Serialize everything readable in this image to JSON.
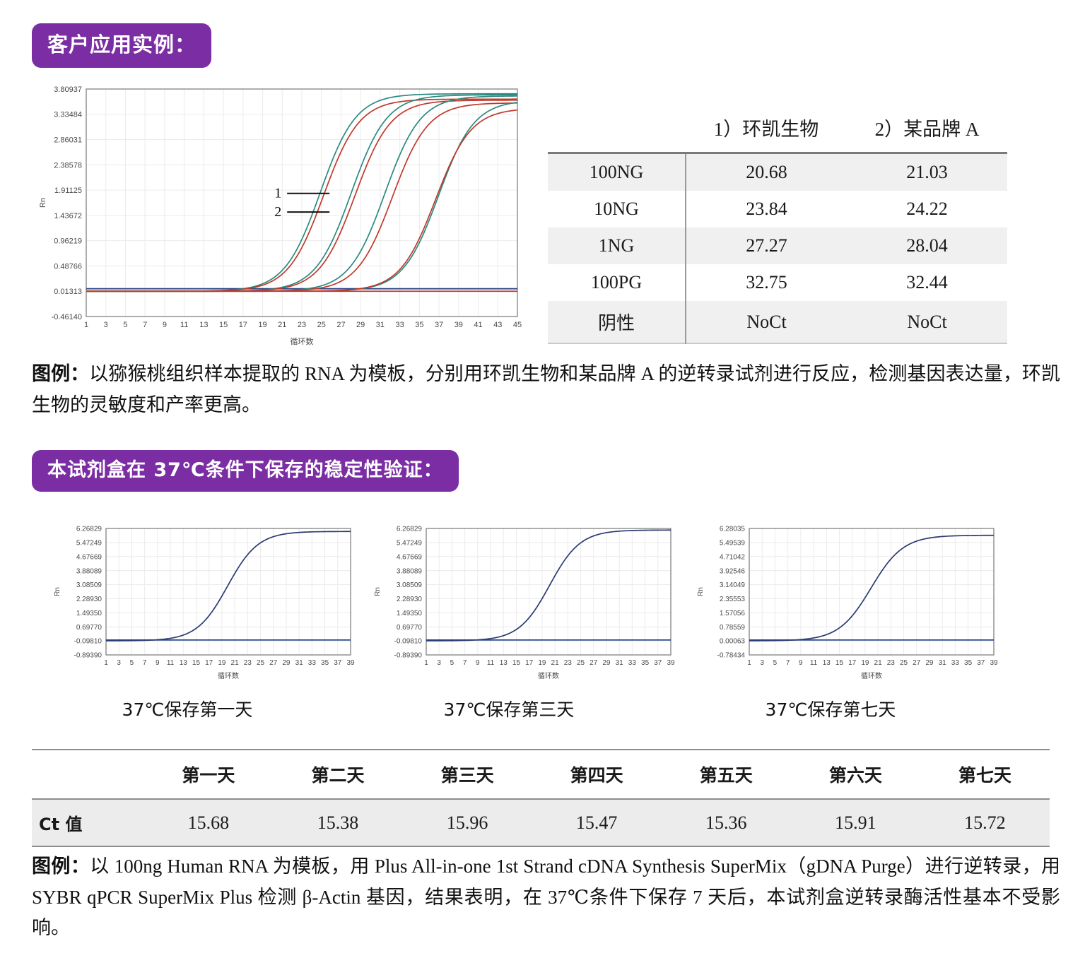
{
  "section1": {
    "badge": "客户应用实例：",
    "caption_prefix": "图例：",
    "caption": "以猕猴桃组织样本提取的 RNA 为模板，分别用环凯生物和某品牌 A 的逆转录试剂进行反应，检测基因表达量，环凯生物的灵敏度和产率更高。",
    "table": {
      "headers": [
        "",
        "1）环凯生物",
        "2）某品牌 A"
      ],
      "rows": [
        {
          "label": "100NG",
          "huankai": "20.68",
          "brand_a": "21.03"
        },
        {
          "label": "10NG",
          "huankai": "23.84",
          "brand_a": "24.22"
        },
        {
          "label": "1NG",
          "huankai": "27.27",
          "brand_a": "28.04"
        },
        {
          "label": "100PG",
          "huankai": "32.75",
          "brand_a": "32.44"
        },
        {
          "label": "阴性",
          "huankai": "NoCt",
          "brand_a": "NoCt"
        }
      ]
    }
  },
  "section2": {
    "badge": "本试剂盒在 37℃条件下保存的稳定性验证：",
    "chart_labels": [
      "37℃保存第一天",
      "37℃保存第三天",
      "37℃保存第七天"
    ],
    "caption_prefix": "图例：",
    "caption": "以 100ng Human RNA 为模板，用 Plus All-in-one 1st Strand cDNA Synthesis SuperMix（gDNA Purge）进行逆转录，用 SYBR qPCR SuperMix Plus 检测 β-Actin 基因，结果表明，在 37℃条件下保存 7 天后，本试剂盒逆转录酶活性基本不受影响。",
    "ct_table": {
      "row_header": "Ct 值",
      "headers": [
        "第一天",
        "第二天",
        "第三天",
        "第四天",
        "第五天",
        "第六天",
        "第七天"
      ],
      "values": [
        "15.68",
        "15.38",
        "15.96",
        "15.47",
        "15.36",
        "15.91",
        "15.72"
      ]
    }
  },
  "colors": {
    "badge_purple": "#7b2ea3",
    "curve_teal": "#2a8a80",
    "curve_red": "#c0392b",
    "curve_navy": "#2b3a72",
    "threshold_blue": "#2c4a8c",
    "grid": "#ebebeb",
    "axis": "#8a8a8a"
  },
  "chart_data": [
    {
      "id": "amplification-comparison",
      "type": "line",
      "title": "",
      "xlabel": "循环数",
      "ylabel": "Rn",
      "xlim": [
        1,
        45
      ],
      "xticks": [
        1,
        3,
        5,
        7,
        9,
        11,
        13,
        15,
        17,
        19,
        21,
        23,
        25,
        27,
        29,
        31,
        33,
        35,
        37,
        39,
        41,
        43,
        45
      ],
      "ylim": [
        -0.4614,
        3.80937
      ],
      "yticks": [
        3.80937,
        3.33484,
        2.86031,
        2.38578,
        1.91125,
        1.43672,
        0.96219,
        0.48766,
        0.01313,
        -0.4614
      ],
      "grid": true,
      "threshold": 0.06,
      "annotations": [
        {
          "text": "1",
          "target_series": "环凯生物",
          "x": 21.5,
          "y": 1.85
        },
        {
          "text": "2",
          "target_series": "某品牌 A",
          "x": 21.5,
          "y": 1.5
        }
      ],
      "series": [
        {
          "name": "环凯生物 100NG",
          "color": "#2a8a80",
          "ct": 20.68,
          "plateau": 3.72,
          "slope": 0.55,
          "baseline": 0.013
        },
        {
          "name": "某品牌 A 100NG",
          "color": "#c0392b",
          "ct": 21.03,
          "plateau": 3.62,
          "slope": 0.55,
          "baseline": 0.013
        },
        {
          "name": "环凯生物 10NG",
          "color": "#2a8a80",
          "ct": 23.84,
          "plateau": 3.7,
          "slope": 0.55,
          "baseline": 0.013
        },
        {
          "name": "某品牌 A 10NG",
          "color": "#c0392b",
          "ct": 24.22,
          "plateau": 3.6,
          "slope": 0.55,
          "baseline": 0.013
        },
        {
          "name": "环凯生物 1NG",
          "color": "#2a8a80",
          "ct": 27.27,
          "plateau": 3.68,
          "slope": 0.55,
          "baseline": 0.013
        },
        {
          "name": "某品牌 A 1NG",
          "color": "#c0392b",
          "ct": 28.04,
          "plateau": 3.55,
          "slope": 0.55,
          "baseline": 0.013
        },
        {
          "name": "环凯生物 100PG",
          "color": "#2a8a80",
          "ct": 32.75,
          "plateau": 3.6,
          "slope": 0.55,
          "baseline": 0.013
        },
        {
          "name": "某品牌 A 100PG",
          "color": "#c0392b",
          "ct": 32.44,
          "plateau": 3.45,
          "slope": 0.55,
          "baseline": 0.013
        },
        {
          "name": "阴性 NoCt",
          "color": "#c0392b",
          "ct": null,
          "plateau": 0.013,
          "slope": 0,
          "baseline": 0.013
        }
      ]
    },
    {
      "id": "stability-day1",
      "type": "line",
      "title": "37℃保存第一天",
      "xlabel": "循环数",
      "ylabel": "Rn",
      "xlim": [
        1,
        39
      ],
      "xticks": [
        1,
        3,
        5,
        7,
        9,
        11,
        13,
        15,
        17,
        19,
        21,
        23,
        25,
        27,
        29,
        31,
        33,
        35,
        37,
        39
      ],
      "ylim": [
        -0.8939,
        6.26829
      ],
      "yticks": [
        6.26829,
        5.47249,
        4.67669,
        3.88089,
        3.08509,
        2.2893,
        1.4935,
        0.6977,
        -0.0981,
        -0.8939
      ],
      "grid": true,
      "threshold": -0.05,
      "series": [
        {
          "name": "β-Actin",
          "color": "#2b3a72",
          "ct": 15.68,
          "plateau": 6.1,
          "slope": 0.42,
          "baseline": -0.098
        }
      ]
    },
    {
      "id": "stability-day3",
      "type": "line",
      "title": "37℃保存第三天",
      "xlabel": "循环数",
      "ylabel": "Rn",
      "xlim": [
        1,
        39
      ],
      "xticks": [
        1,
        3,
        5,
        7,
        9,
        11,
        13,
        15,
        17,
        19,
        21,
        23,
        25,
        27,
        29,
        31,
        33,
        35,
        37,
        39
      ],
      "ylim": [
        -0.8939,
        6.26829
      ],
      "yticks": [
        6.26829,
        5.47249,
        4.67669,
        3.88089,
        3.08509,
        2.2893,
        1.4935,
        0.6977,
        -0.0981,
        -0.8939
      ],
      "grid": true,
      "threshold": -0.05,
      "series": [
        {
          "name": "β-Actin",
          "color": "#2b3a72",
          "ct": 15.96,
          "plateau": 6.18,
          "slope": 0.42,
          "baseline": -0.098
        }
      ]
    },
    {
      "id": "stability-day7",
      "type": "line",
      "title": "37℃保存第七天",
      "xlabel": "循环数",
      "ylabel": "Rn",
      "xlim": [
        1,
        39
      ],
      "xticks": [
        1,
        3,
        5,
        7,
        9,
        11,
        13,
        15,
        17,
        19,
        21,
        23,
        25,
        27,
        29,
        31,
        33,
        35,
        37,
        39
      ],
      "ylim": [
        -0.78434,
        6.28035
      ],
      "yticks": [
        6.28035,
        5.49539,
        4.71042,
        3.92546,
        3.14049,
        2.35553,
        1.57056,
        0.78559,
        0.00063,
        -0.78434
      ],
      "grid": true,
      "threshold": 0.05,
      "series": [
        {
          "name": "β-Actin",
          "color": "#2b3a72",
          "ct": 15.72,
          "plateau": 5.9,
          "slope": 0.4,
          "baseline": 0.0006
        }
      ]
    }
  ]
}
